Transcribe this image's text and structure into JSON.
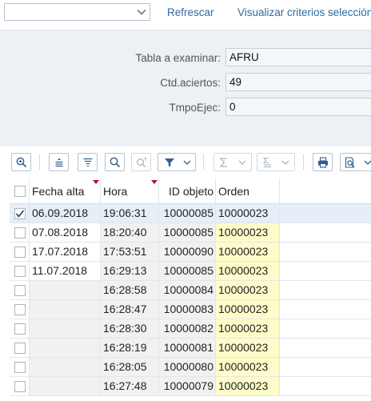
{
  "toolbar": {
    "combo_value": "",
    "refresh_label": "Refrescar",
    "criteria_label": "Visualizar criterios selección"
  },
  "selection": {
    "fields": [
      {
        "label": "Tabla a examinar:",
        "value": "AFRU"
      },
      {
        "label": "Ctd.aciertos:",
        "value": "49"
      },
      {
        "label": "TmpoEjec:",
        "value": "0"
      }
    ]
  },
  "grid_toolbar": {
    "icons": [
      "zoom-in-icon",
      "align-center-icon",
      "align-filter-icon",
      "search-icon",
      "search-next-icon",
      "filter-icon",
      "sum-icon",
      "subtotal-icon",
      "print-icon",
      "print-preview-icon"
    ]
  },
  "table": {
    "headers": {
      "fecha": "Fecha alta",
      "hora": "Hora",
      "id": "ID objeto",
      "orden": "Orden"
    },
    "rows": [
      {
        "checked": true,
        "fecha": "06.09.2018",
        "hora": "19:06:31",
        "id": "10000085",
        "orden": "10000023"
      },
      {
        "checked": false,
        "fecha": "07.08.2018",
        "hora": "18:20:40",
        "id": "10000085",
        "orden": "10000023"
      },
      {
        "checked": false,
        "fecha": "17.07.2018",
        "hora": "17:53:51",
        "id": "10000090",
        "orden": "10000023"
      },
      {
        "checked": false,
        "fecha": "11.07.2018",
        "hora": "16:29:13",
        "id": "10000085",
        "orden": "10000023"
      },
      {
        "checked": false,
        "fecha": "",
        "hora": "16:28:58",
        "id": "10000084",
        "orden": "10000023"
      },
      {
        "checked": false,
        "fecha": "",
        "hora": "16:28:47",
        "id": "10000083",
        "orden": "10000023"
      },
      {
        "checked": false,
        "fecha": "",
        "hora": "16:28:30",
        "id": "10000082",
        "orden": "10000023"
      },
      {
        "checked": false,
        "fecha": "",
        "hora": "16:28:19",
        "id": "10000081",
        "orden": "10000023"
      },
      {
        "checked": false,
        "fecha": "",
        "hora": "16:28:05",
        "id": "10000080",
        "orden": "10000023"
      },
      {
        "checked": false,
        "fecha": "",
        "hora": "16:27:48",
        "id": "10000079",
        "orden": "10000023"
      }
    ]
  },
  "colors": {
    "link": "#2f6aa1",
    "selection_bg": "#edf0f4",
    "orden_column": "#fffcc9",
    "selected_row": "#e6eef8",
    "sort_marker": "#b5121b"
  }
}
